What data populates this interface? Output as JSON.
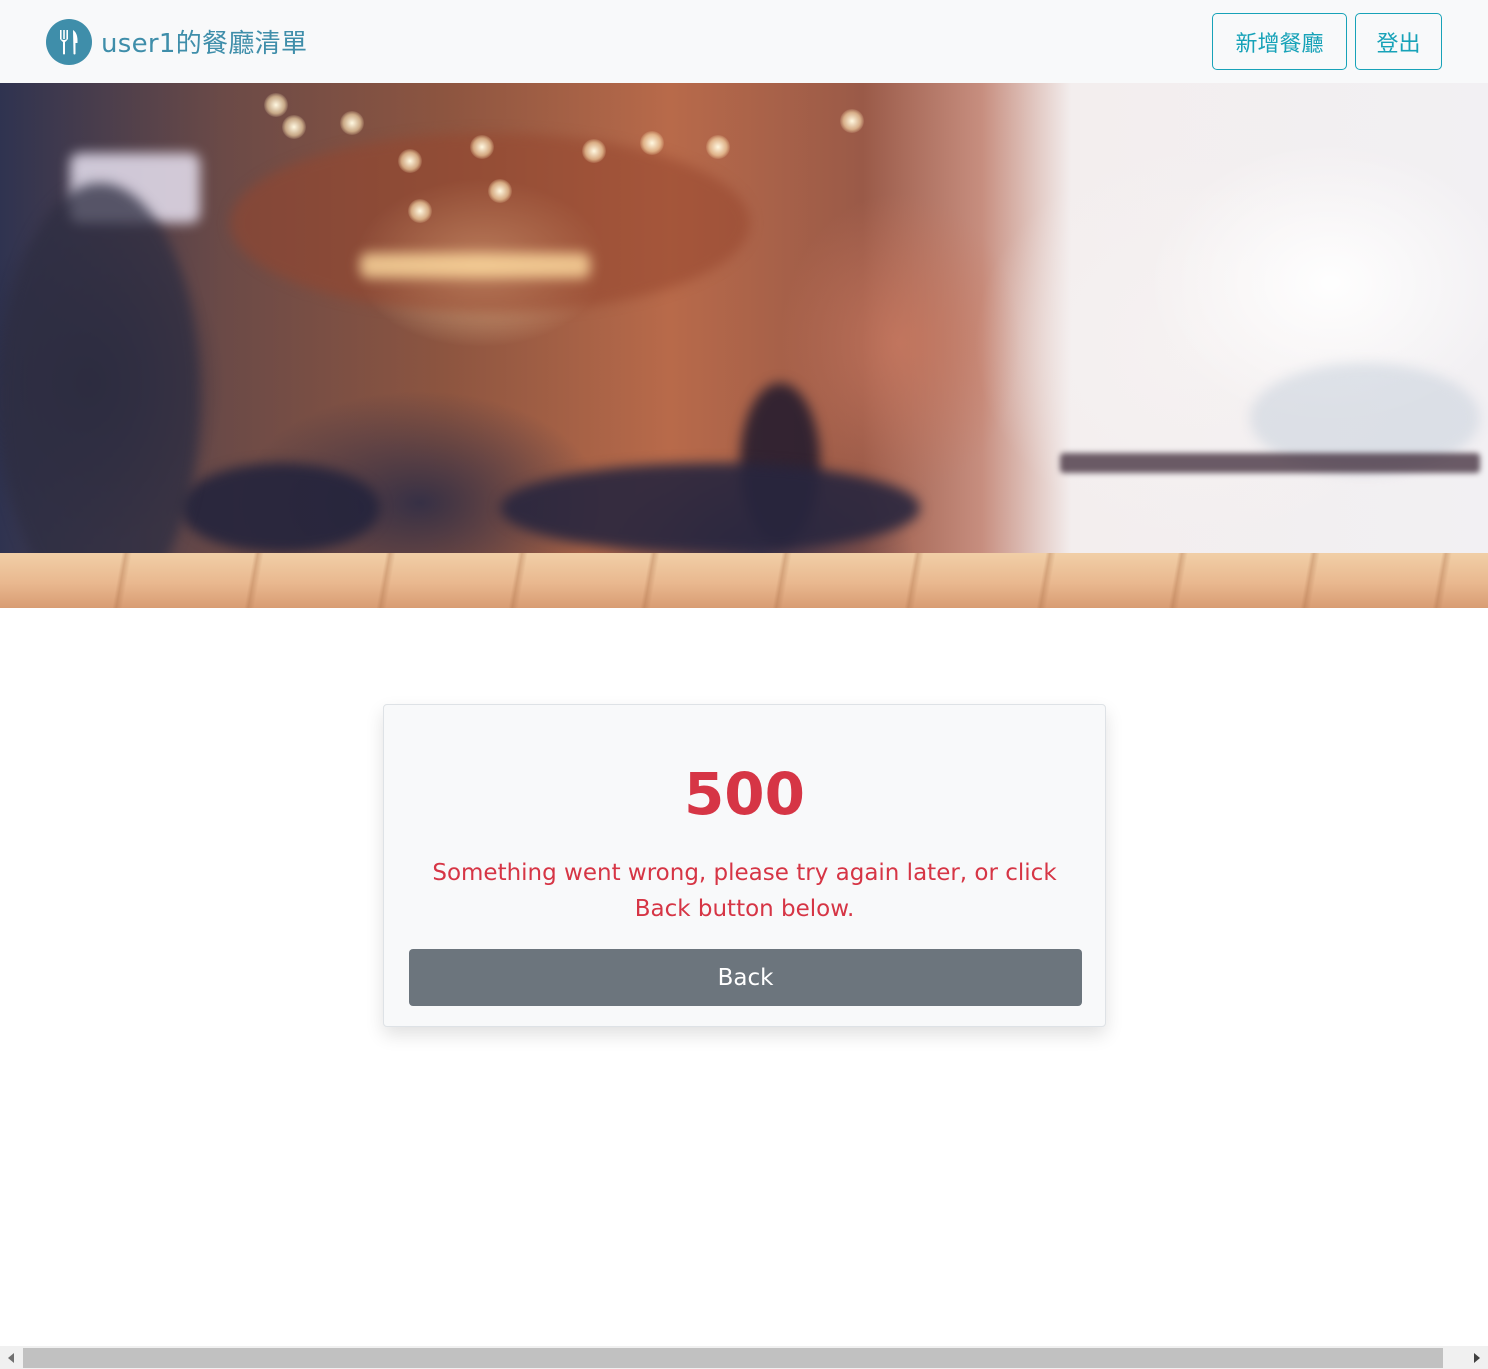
{
  "navbar": {
    "brand_text": "user1的餐廳清單",
    "brand_icon": "utensils-icon",
    "add_restaurant_label": "新增餐廳",
    "logout_label": "登出",
    "accent_color": "#17a2b8"
  },
  "hero": {
    "image": "blurred-restaurant-interior"
  },
  "error": {
    "code": "500",
    "message": "Something went wrong, please try again later, or click Back button below.",
    "back_label": "Back",
    "error_color": "#d63545",
    "button_color": "#6c757d"
  },
  "scrollbar": {
    "left_arrow": "scroll-left-icon",
    "right_arrow": "scroll-right-icon"
  }
}
